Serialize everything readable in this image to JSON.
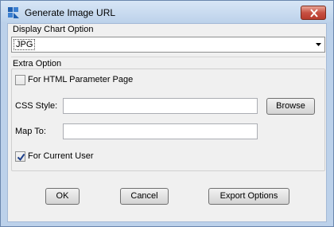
{
  "window": {
    "title": "Generate Image URL"
  },
  "display_chart": {
    "section_label": "Display Chart Option",
    "selected_value": "JPG"
  },
  "extra": {
    "section_label": "Extra Option",
    "html_param_label": "For HTML Parameter Page",
    "html_param_checked": false,
    "css_label": "CSS Style:",
    "css_value": "",
    "browse_label": "Browse",
    "map_label": "Map To:",
    "map_value": "",
    "current_user_label": "For Current User",
    "current_user_checked": true
  },
  "footer": {
    "ok_label": "OK",
    "cancel_label": "Cancel",
    "export_label": "Export Options"
  }
}
